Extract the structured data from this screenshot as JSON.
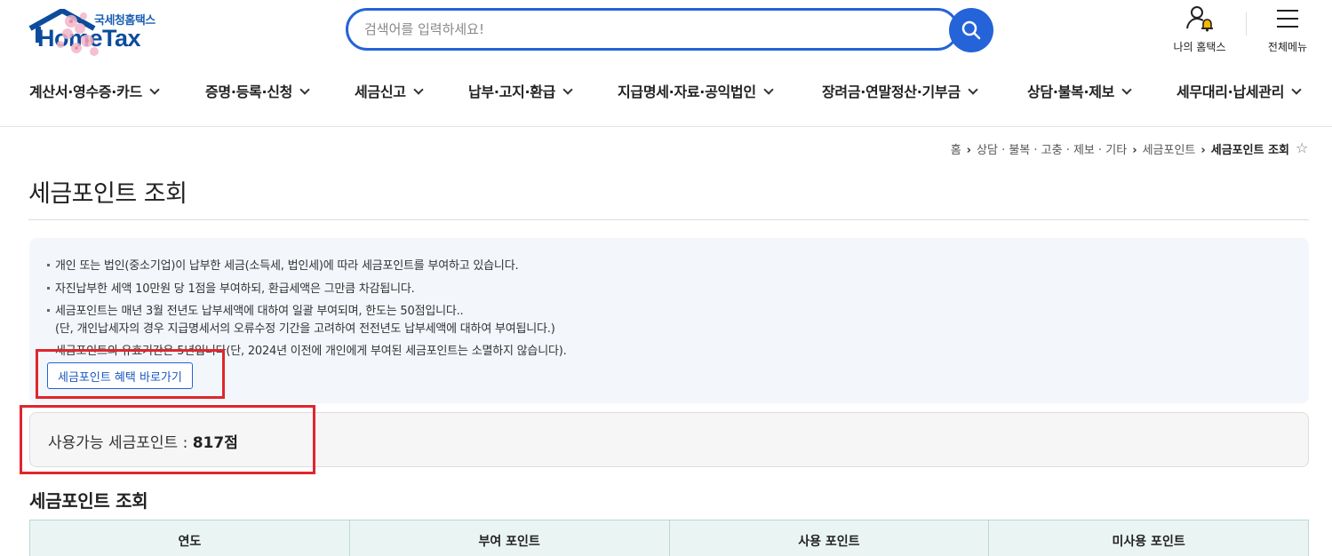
{
  "header": {
    "logo_sub": "국세청홈택스",
    "logo_main": "HomeTax",
    "search_placeholder": "검색어를 입력하세요!",
    "my_hometax": "나의 홈택스",
    "all_menu": "전체메뉴"
  },
  "nav": {
    "items": [
      {
        "label": "계산서·영수증·카드"
      },
      {
        "label": "증명·등록·신청"
      },
      {
        "label": "세금신고"
      },
      {
        "label": "납부·고지·환급"
      },
      {
        "label": "지급명세·자료·공익법인"
      },
      {
        "label": "장려금·연말정산·기부금"
      },
      {
        "label": "상담·불복·제보"
      },
      {
        "label": "세무대리·납세관리"
      }
    ]
  },
  "breadcrumb": {
    "home": "홈",
    "level1": "상담 · 불복 · 고충 · 제보 · 기타",
    "level2": "세금포인트",
    "current": "세금포인트 조회"
  },
  "page": {
    "title": "세금포인트 조회"
  },
  "info": {
    "lines": [
      "개인 또는 법인(중소기업)이 납부한 세금(소득세, 법인세)에 따라 세금포인트를 부여하고 있습니다.",
      "자진납부한 세액 10만원 당 1점을 부여하되, 환급세액은 그만큼 차감됩니다.",
      "세금포인트는 매년 3월 전년도 납부세액에 대하여 일괄 부여되며, 한도는 50점입니다..",
      "(단, 개인납세자의 경우 지급명세서의 오류수정 기간을 고려하여 전전년도 납부세액에 대하여 부여됩니다.)",
      "세금포인트의 유효기간은 5년입니다(단, 2024년 이전에 개인에게 부여된 세금포인트는 소멸하지 않습니다)."
    ],
    "benefit_button": "세금포인트 혜택 바로가기"
  },
  "points": {
    "label": "사용가능 세금포인트 : ",
    "value": "817점"
  },
  "section": {
    "title": "세금포인트 조회"
  },
  "table": {
    "headers": [
      "연도",
      "부여 포인트",
      "사용 포인트",
      "미사용 포인트"
    ]
  },
  "colors": {
    "primary": "#2463d8",
    "highlight": "#e0262d",
    "logo": "#0d4c9c",
    "table_header_bg": "#eaf5f3"
  }
}
